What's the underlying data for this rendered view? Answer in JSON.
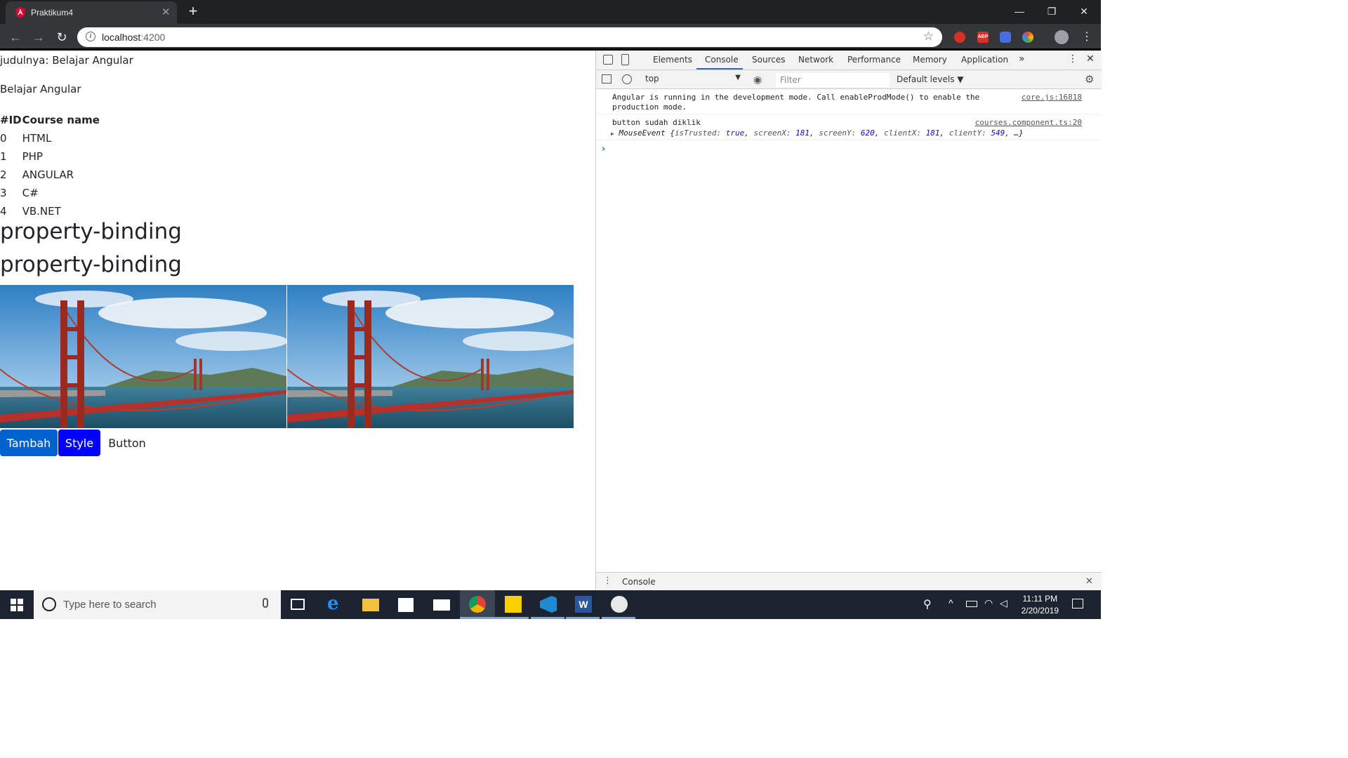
{
  "browser": {
    "tab_title": "Praktikum4",
    "tab_close": "✕",
    "new_tab": "+",
    "url_host": "localhost",
    "url_port": ":4200",
    "window_controls": {
      "minimize": "—",
      "restore": "❐",
      "close": "✕"
    },
    "extensions": [
      "adblock-icon",
      "abp-icon",
      "extension-icon",
      "color-picker-icon",
      "profile-avatar"
    ]
  },
  "page": {
    "title_line": "judulnya: Belajar Angular",
    "subtitle": "Belajar Angular",
    "table": {
      "headers": [
        "#ID",
        "Course name"
      ],
      "rows": [
        [
          "0",
          "HTML"
        ],
        [
          "1",
          "PHP"
        ],
        [
          "2",
          "ANGULAR"
        ],
        [
          "3",
          "C#"
        ],
        [
          "4",
          "VB.NET"
        ]
      ]
    },
    "heading1": "property-binding",
    "heading2": "property-binding",
    "buttons": {
      "tambah": "Tambah",
      "style": "Style",
      "plain": "Button"
    }
  },
  "devtools": {
    "tabs": [
      "Elements",
      "Console",
      "Sources",
      "Network",
      "Performance",
      "Memory",
      "Application"
    ],
    "active_tab": "Console",
    "more": "»",
    "context": "top",
    "filter_placeholder": "Filter",
    "levels": "Default levels ▼",
    "messages": [
      {
        "text1": "Angular is running in the development mode. Call enableProdMode() to enable the",
        "text2": "production mode.",
        "source": "core.js:16818"
      },
      {
        "text1": "button sudah diklik",
        "source": "courses.component.ts:20"
      }
    ],
    "event_object": {
      "prefix": "▶",
      "name": "MouseEvent",
      "open": "{",
      "k1": "isTrusted:",
      "v1": "true",
      "k2": "screenX:",
      "v2": "181",
      "k3": "screenY:",
      "v3": "620",
      "k4": "clientX:",
      "v4": "181",
      "k5": "clientY:",
      "v5": "549",
      "tail": "…}"
    },
    "prompt": "›",
    "drawer_title": "Console"
  },
  "taskbar": {
    "search_placeholder": "Type here to search",
    "time": "11:11 PM",
    "date": "2/20/2019"
  },
  "colors": {
    "accent_blue": "#1a73e8",
    "button_primary": "#0062cc",
    "button_style": "#0000ff",
    "taskbar": "#1b2430"
  }
}
